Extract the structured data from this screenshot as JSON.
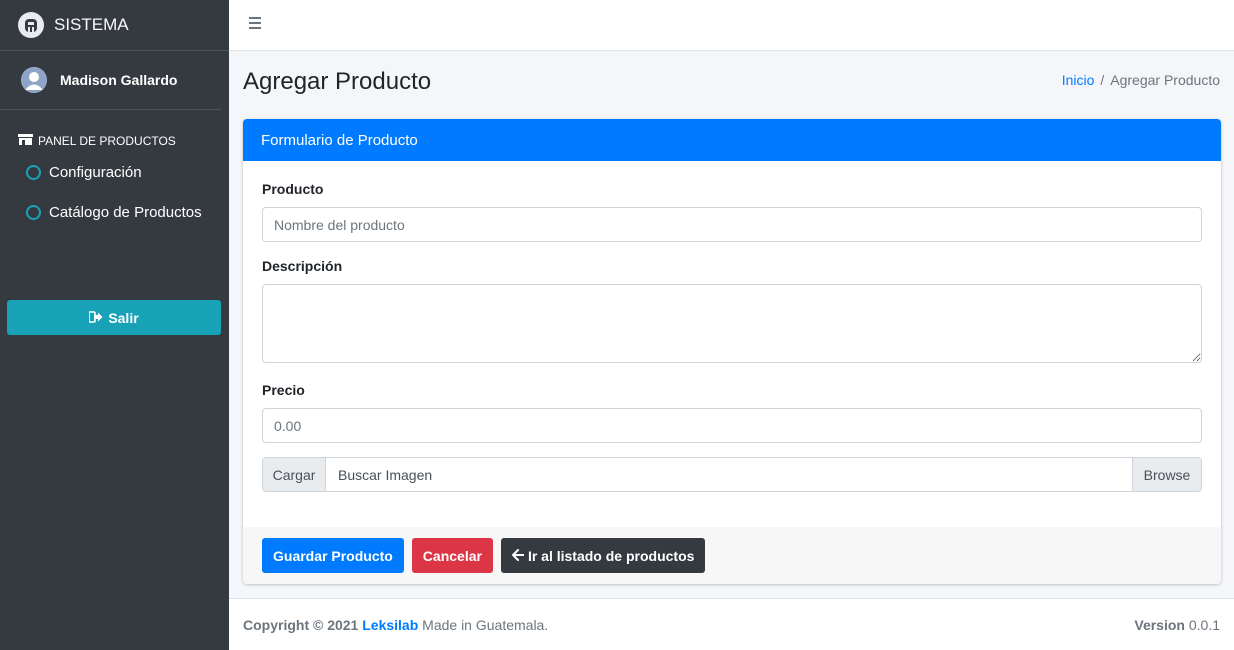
{
  "sidebar": {
    "brand": "SISTEMA",
    "user_name": "Madison Gallardo",
    "section_title": "PANEL DE PRODUCTOS",
    "items": [
      {
        "label": "Configuración"
      },
      {
        "label": "Catálogo de Productos"
      }
    ],
    "logout_label": "Salir"
  },
  "header": {
    "page_title": "Agregar Producto",
    "breadcrumb": {
      "home": "Inicio",
      "separator": "/",
      "current": "Agregar Producto"
    }
  },
  "form": {
    "card_title": "Formulario de Producto",
    "product_label": "Producto",
    "product_placeholder": "Nombre del producto",
    "description_label": "Descripción",
    "price_label": "Precio",
    "price_placeholder": "0.00",
    "file_prefix": "Cargar",
    "file_label": "Buscar Imagen",
    "file_browse": "Browse"
  },
  "actions": {
    "save": "Guardar Producto",
    "cancel": "Cancelar",
    "back": "Ir al listado de productos"
  },
  "footer": {
    "copyright": "Copyright © 2021",
    "company": "Leksilab",
    "made_in": "Made in Guatemala.",
    "version_label": "Version",
    "version_value": "0.0.1"
  },
  "colors": {
    "sidebar_bg": "#343a40",
    "primary": "#007bff",
    "info": "#17a2b8",
    "danger": "#dc3545",
    "dark": "#343a40"
  },
  "icons": {
    "brand": "logo-icon",
    "user": "user-avatar-icon",
    "section": "store-icon",
    "nav_item": "circle-icon",
    "logout": "sign-out-icon",
    "menu": "hamburger-icon",
    "back": "arrow-left-icon"
  }
}
